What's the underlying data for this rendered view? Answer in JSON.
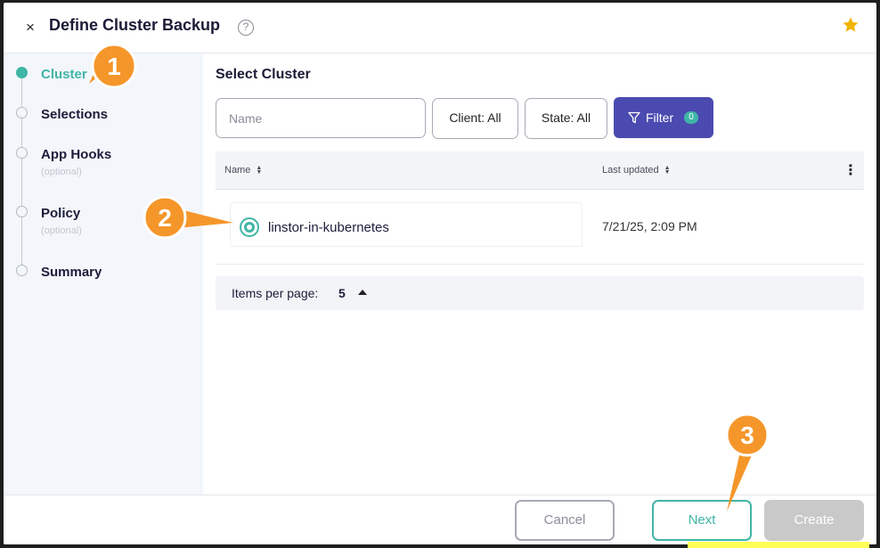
{
  "header": {
    "close_glyph": "×",
    "title": "Define Cluster Backup",
    "help_glyph": "?",
    "favorite_icon": "star-icon",
    "favorite_color": "#f0b400"
  },
  "steps": [
    {
      "label": "Cluster",
      "sub": "",
      "active": true
    },
    {
      "label": "Selections",
      "sub": "",
      "active": false
    },
    {
      "label": "App Hooks",
      "sub": "(optional)",
      "active": false
    },
    {
      "label": "Policy",
      "sub": "(optional)",
      "active": false
    },
    {
      "label": "Summary",
      "sub": "",
      "active": false
    }
  ],
  "main": {
    "section_title": "Select Cluster",
    "search": {
      "placeholder": "Name",
      "value": ""
    },
    "client_filter": "Client: All",
    "state_filter": "State: All",
    "filter_button": {
      "label": "Filter",
      "count": "0"
    },
    "table": {
      "columns": [
        "Name",
        "Last updated"
      ],
      "rows": [
        {
          "name": "linstor-in-kubernetes",
          "last_updated": "7/21/25, 2:09 PM",
          "selected": true
        }
      ]
    },
    "pagination": {
      "label": "Items per page:",
      "value": "5"
    }
  },
  "footer": {
    "cancel": "Cancel",
    "next": "Next",
    "create": "Create"
  },
  "callouts": [
    "1",
    "2",
    "3"
  ],
  "colors": {
    "accent_teal": "#3fb5a6",
    "primary_purple": "#4b4ab0",
    "callout_orange": "#f5962a"
  }
}
